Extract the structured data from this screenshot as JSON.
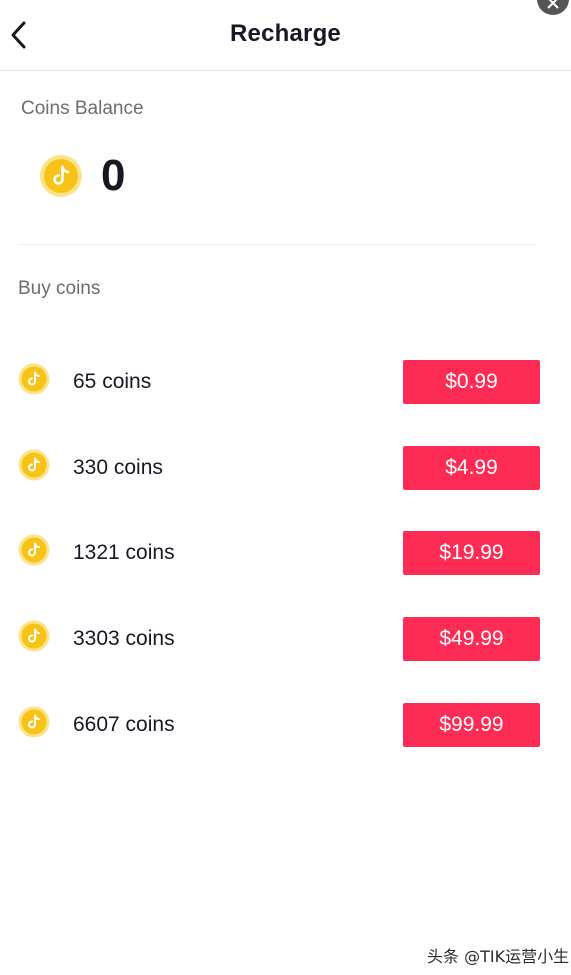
{
  "header": {
    "title": "Recharge"
  },
  "balance": {
    "label": "Coins Balance",
    "value": "0"
  },
  "buy": {
    "label": "Buy coins",
    "packages": [
      {
        "coins": "65 coins",
        "price": "$0.99"
      },
      {
        "coins": "330 coins",
        "price": "$4.99"
      },
      {
        "coins": "1321 coins",
        "price": "$19.99"
      },
      {
        "coins": "3303 coins",
        "price": "$49.99"
      },
      {
        "coins": "6607 coins",
        "price": "$99.99"
      }
    ]
  },
  "watermark": "头条 @TIK运营小生",
  "colors": {
    "accent": "#fe2c55",
    "coin_gold": "#f7c317",
    "text": "#161823",
    "muted": "#6b6d72"
  }
}
